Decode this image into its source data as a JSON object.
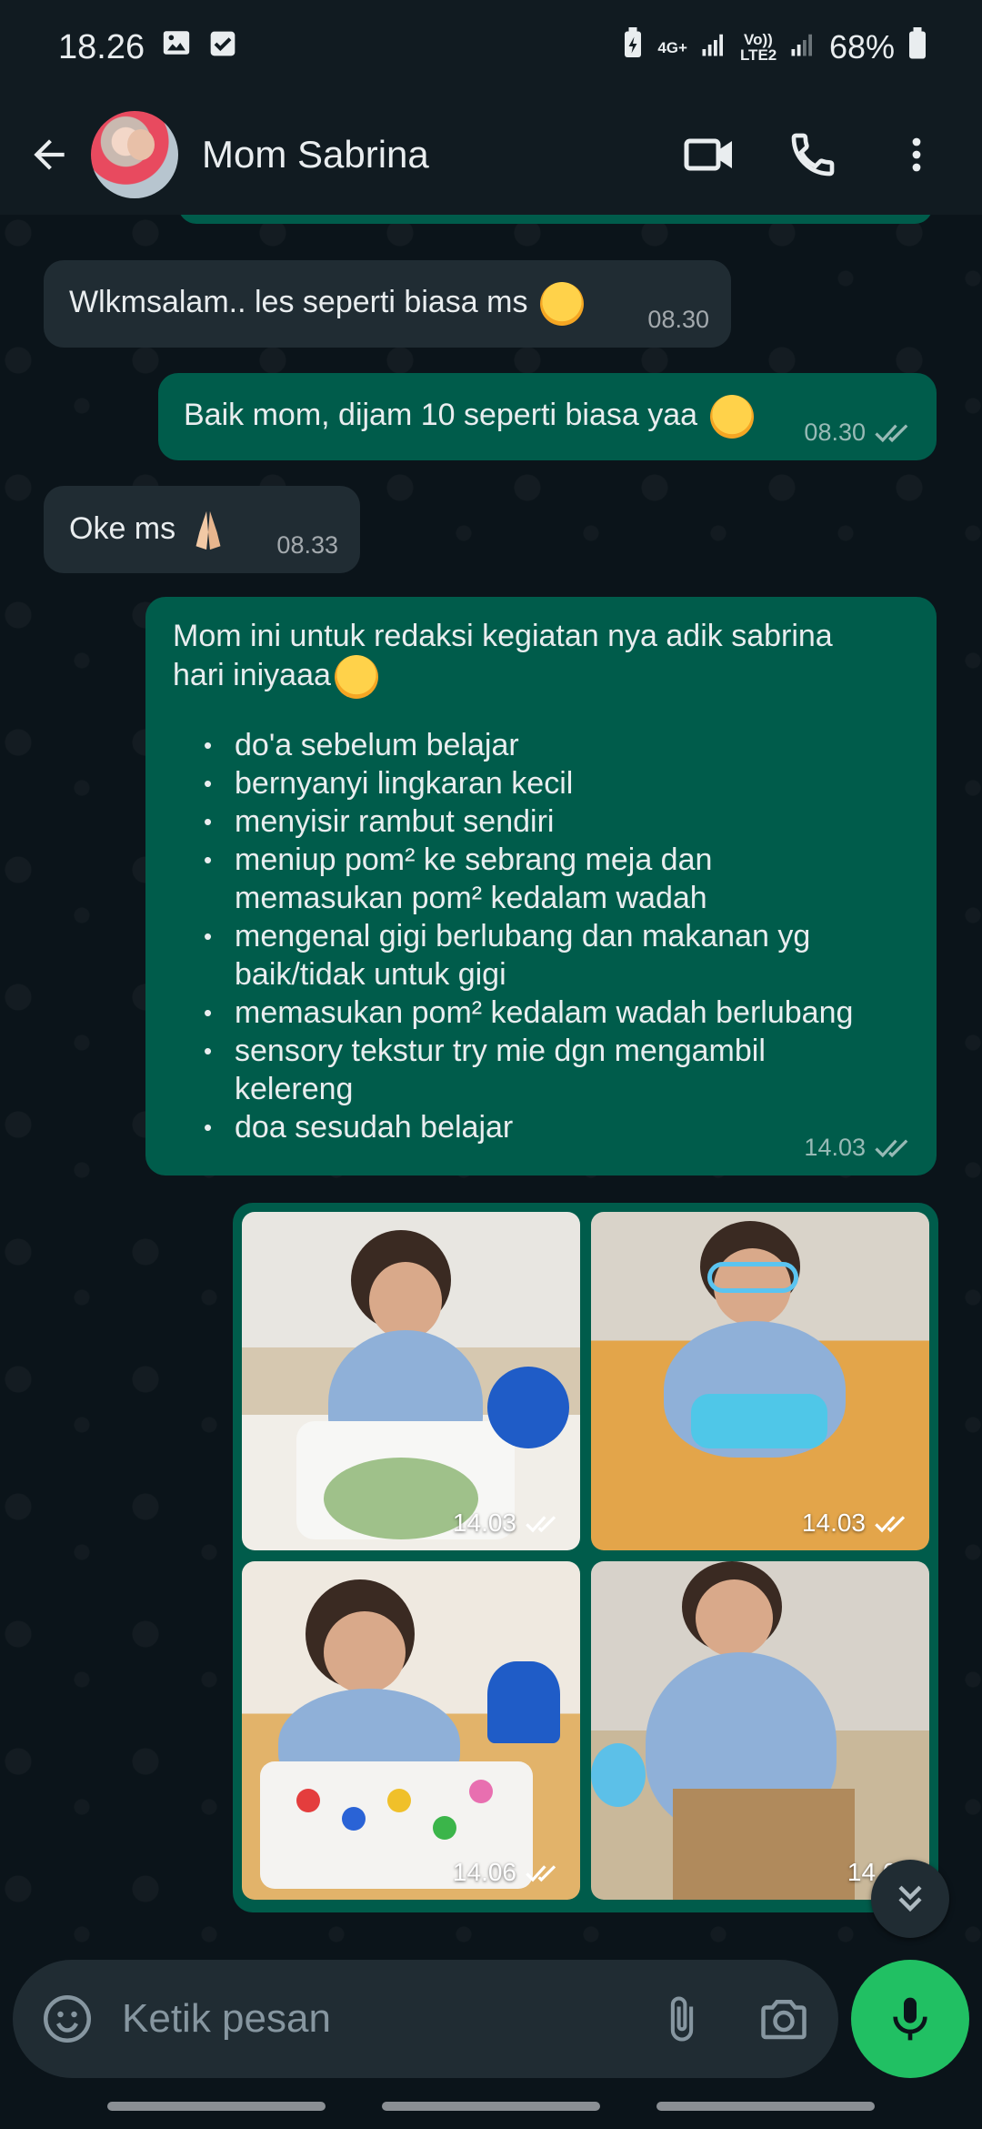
{
  "status_bar": {
    "time": "18.26",
    "network_1": "4G+",
    "network_2": "Vo)) LTE2",
    "battery": "68%"
  },
  "header": {
    "contact_name": "Mom Sabrina"
  },
  "messages": [
    {
      "id": "m1",
      "direction": "incoming",
      "text": "Wlkmsalam.. les seperti biasa ms",
      "time": "08.30"
    },
    {
      "id": "m2",
      "direction": "outgoing",
      "text": "Baik mom, dijam 10 seperti biasa yaa",
      "time": "08.30",
      "status": "read"
    },
    {
      "id": "m3",
      "direction": "incoming",
      "text": "Oke ms",
      "time": "08.33"
    },
    {
      "id": "m4",
      "direction": "outgoing",
      "intro": [
        "Mom ini untuk redaksi kegiatan nya adik sabrina",
        "hari iniyaaa"
      ],
      "list": [
        "do'a sebelum belajar",
        "bernyanyi lingkaran kecil",
        "menyisir rambut sendiri",
        "meniup pom² ke sebrang meja dan memasukan pom² kedalam wadah",
        "mengenal gigi berlubang dan makanan yg baik/tidak untuk gigi",
        "memasukan pom² kedalam wadah berlubang",
        "sensory tekstur try mie dgn mengambil kelereng",
        "doa sesudah belajar"
      ],
      "time": "14.03",
      "status": "read"
    }
  ],
  "photos": [
    {
      "time": "14.03",
      "status": "read"
    },
    {
      "time": "14.03",
      "status": "read"
    },
    {
      "time": "14.06",
      "status": "read"
    },
    {
      "time": "14.06"
    }
  ],
  "composer": {
    "placeholder": "Ketik pesan"
  },
  "colors": {
    "incoming_bubble": "#202c33",
    "outgoing_bubble": "#005c4b",
    "background": "#0b141a",
    "accent": "#21c063"
  }
}
